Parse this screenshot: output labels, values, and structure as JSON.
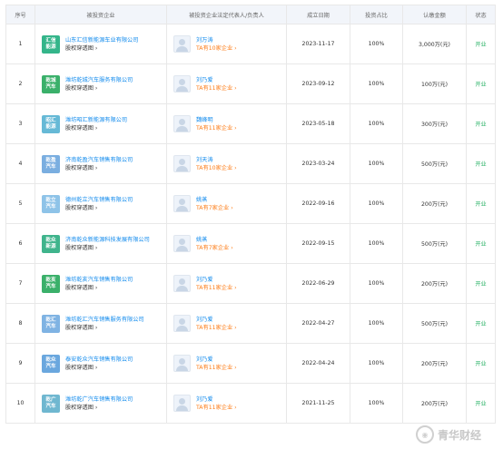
{
  "headers": [
    "序号",
    "被投资企业",
    "被投资企业法定代表人/负责人",
    "成立日期",
    "投资占比",
    "认缴金额",
    "状态"
  ],
  "equity_link": "股权穿透图",
  "rows": [
    {
      "no": "1",
      "logo": [
        "汇信",
        "能源"
      ],
      "logo_color": "#34b58a",
      "company": "山东汇信新能源车业有限公司",
      "person": "刘万涛",
      "count": "TA有10家企业",
      "date": "2023-11-17",
      "ratio": "100%",
      "amount": "3,000万(元)",
      "status": "开业"
    },
    {
      "no": "2",
      "logo": [
        "乾城",
        "汽车"
      ],
      "logo_color": "#3ab06a",
      "company": "潍坊乾城汽车服务有限公司",
      "person": "刘乃爱",
      "count": "TA有11家企业",
      "date": "2023-09-12",
      "ratio": "100%",
      "amount": "100万(元)",
      "status": "开业"
    },
    {
      "no": "3",
      "logo": [
        "昭汇",
        "能源"
      ],
      "logo_color": "#66b9d6",
      "company": "潍坊昭汇新能源有限公司",
      "person": "魏峰明",
      "count": "TA有11家企业",
      "date": "2023-05-18",
      "ratio": "100%",
      "amount": "300万(元)",
      "status": "开业"
    },
    {
      "no": "4",
      "logo": [
        "乾盈",
        "汽车"
      ],
      "logo_color": "#7aaee0",
      "company": "济南乾盈汽车销售有限公司",
      "person": "刘天涛",
      "count": "TA有10家企业",
      "date": "2023-03-24",
      "ratio": "100%",
      "amount": "500万(元)",
      "status": "开业"
    },
    {
      "no": "5",
      "logo": [
        "乾立",
        "汽车"
      ],
      "logo_color": "#8ec3e8",
      "company": "德州乾立汽车销售有限公司",
      "person": "姚蒸",
      "count": "TA有7家企业",
      "date": "2022-09-16",
      "ratio": "100%",
      "amount": "200万(元)",
      "status": "开业"
    },
    {
      "no": "6",
      "logo": [
        "乾众",
        "新源"
      ],
      "logo_color": "#3fb48c",
      "company": "济南乾众新能源科技发展有限公司",
      "person": "姚蒸",
      "count": "TA有7家企业",
      "date": "2022-09-15",
      "ratio": "100%",
      "amount": "500万(元)",
      "status": "开业"
    },
    {
      "no": "7",
      "logo": [
        "乾亥",
        "汽车"
      ],
      "logo_color": "#3ab06a",
      "company": "潍坊乾亥汽车销售有限公司",
      "person": "刘乃爱",
      "count": "TA有11家企业",
      "date": "2022-06-29",
      "ratio": "100%",
      "amount": "200万(元)",
      "status": "开业"
    },
    {
      "no": "8",
      "logo": [
        "乾汇",
        "汽车"
      ],
      "logo_color": "#7fb3e3",
      "company": "潍坊乾汇汽车销售服务有限公司",
      "person": "刘乃爱",
      "count": "TA有11家企业",
      "date": "2022-04-27",
      "ratio": "100%",
      "amount": "500万(元)",
      "status": "开业"
    },
    {
      "no": "9",
      "logo": [
        "乾众",
        "汽车"
      ],
      "logo_color": "#6aa7de",
      "company": "泰安乾众汽车销售有限公司",
      "person": "刘乃爱",
      "count": "TA有11家企业",
      "date": "2022-04-24",
      "ratio": "100%",
      "amount": "200万(元)",
      "status": "开业"
    },
    {
      "no": "10",
      "logo": [
        "乾广",
        "汽车"
      ],
      "logo_color": "#6fb7d0",
      "company": "潍坊乾广汽车销售有限公司",
      "person": "刘乃爱",
      "count": "TA有11家企业",
      "date": "2021-11-25",
      "ratio": "100%",
      "amount": "200万(元)",
      "status": "开业"
    }
  ],
  "watermark": "青华财经"
}
